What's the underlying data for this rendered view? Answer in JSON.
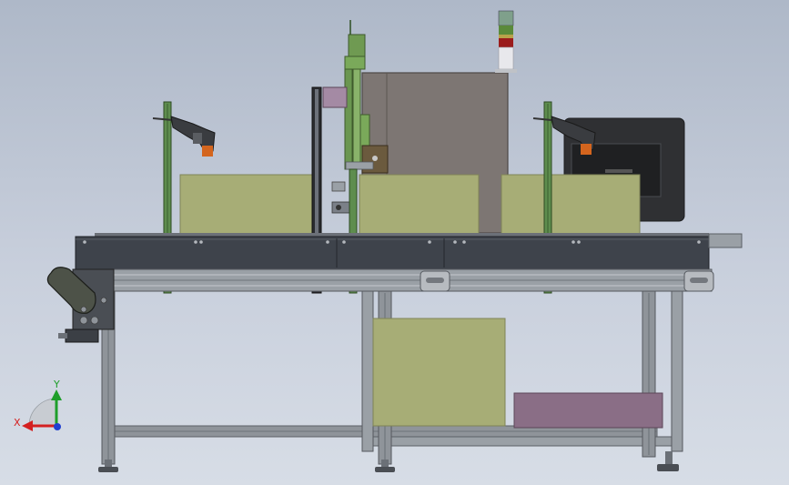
{
  "triad": {
    "x_label": "X",
    "y_label": "Y",
    "x_color": "#d42020",
    "y_color": "#1e9e2a",
    "z_color": "#1f3fd0"
  },
  "colors": {
    "background_top": "#aeb8c8",
    "background_bottom": "#d7dde6",
    "frame": "#8f949a",
    "frame_dark": "#3c3f44",
    "conveyor_belt": "#3e434b",
    "product_box": "#a7ad76",
    "product_box_dark": "#9c9f72",
    "purple_part": "#8a6e86",
    "green_rail": "#5e8d4e",
    "cabinet": "#7d7673",
    "monitor": "#2f3033",
    "signal_light_red": "#9b1c1c",
    "signal_light_green": "#5a8a3a",
    "signal_light_yellow": "#b8a24a"
  },
  "components": {
    "tower_light": "tower-light",
    "left_scanner": "barcode-scanner-left",
    "right_scanner": "barcode-scanner-right",
    "monitor": "monitor",
    "cabinet": "control-cabinet",
    "conveyor": "belt-conveyor",
    "frame": "aluminum-frame",
    "drive_motor": "drive-motor"
  }
}
